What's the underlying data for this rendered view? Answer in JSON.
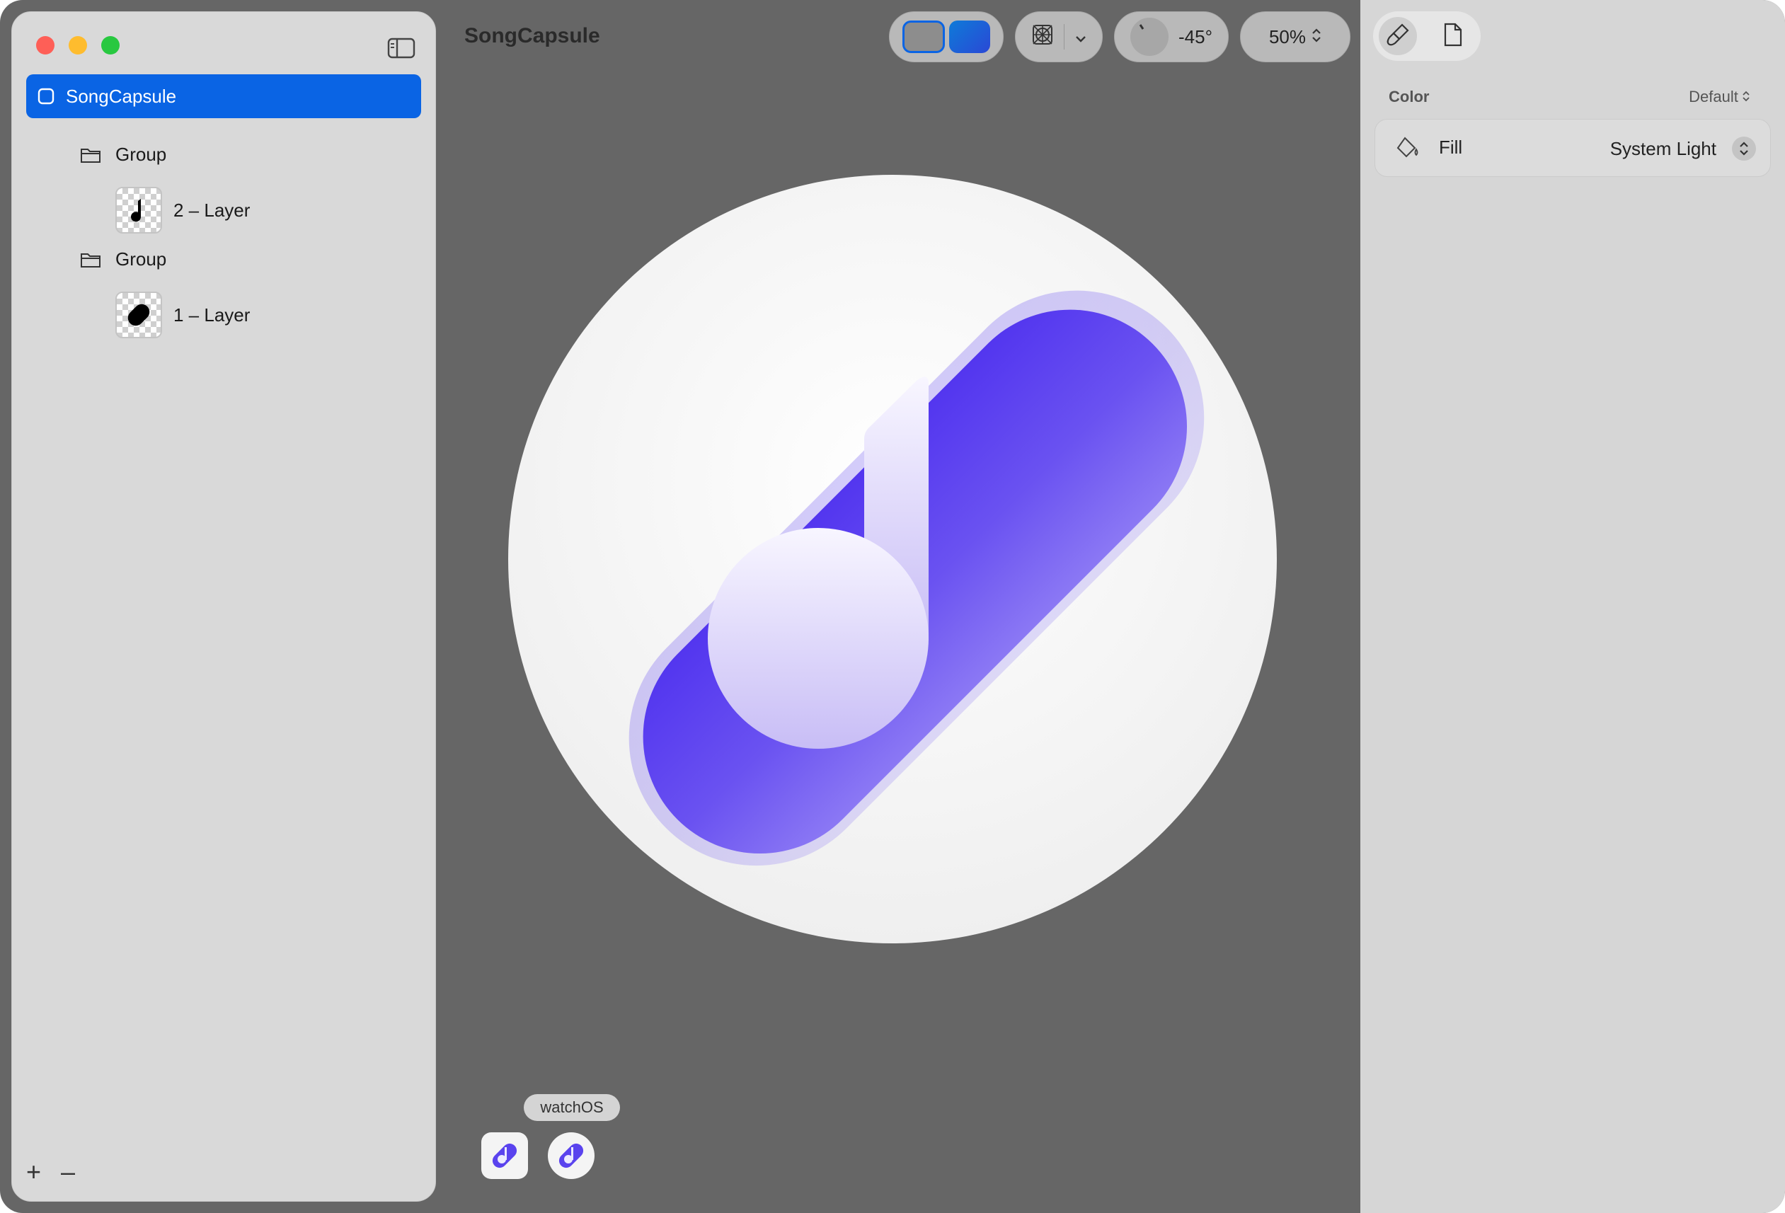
{
  "window": {
    "title": "SongCapsule"
  },
  "sidebar": {
    "items": [
      {
        "label": "SongCapsule",
        "kind": "root",
        "selected": true
      },
      {
        "label": "Group",
        "kind": "group"
      },
      {
        "label": "2 – Layer",
        "kind": "layer"
      },
      {
        "label": "Group",
        "kind": "group"
      },
      {
        "label": "1 – Layer",
        "kind": "layer"
      }
    ],
    "add_label": "+",
    "remove_label": "–"
  },
  "toolbar": {
    "angle": "-45°",
    "zoom": "50%"
  },
  "inspector": {
    "section_label": "Color",
    "section_value": "Default",
    "fill_label": "Fill",
    "fill_value": "System Light"
  },
  "canvas": {
    "platform_label": "watchOS",
    "icon_colors": {
      "accent": "#5a43ee",
      "accent_light": "#8a78f4",
      "background": "#f4f4f4"
    }
  },
  "colors": {
    "canvas_bg": "#666666",
    "selection": "#0a64e4",
    "sidebar_bg": "#d9d9d9",
    "inspector_bg": "#d6d6d6"
  }
}
